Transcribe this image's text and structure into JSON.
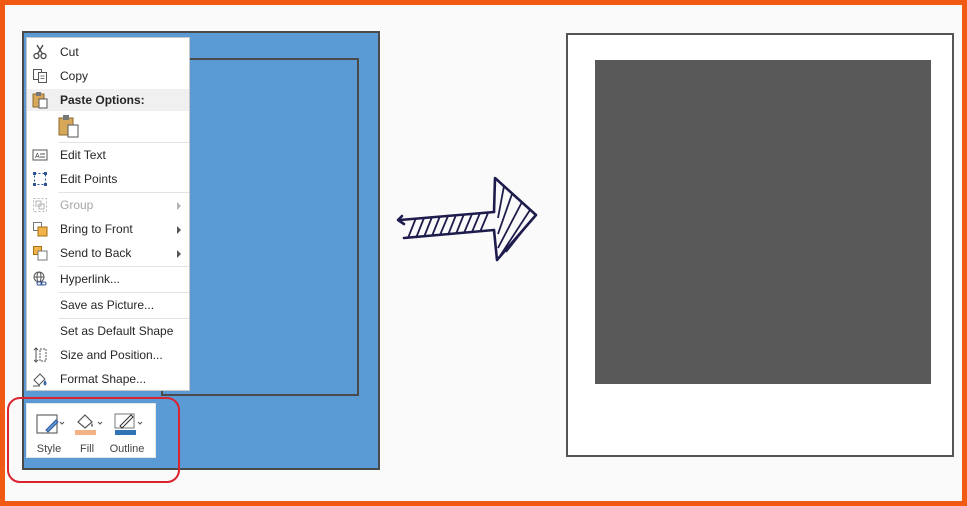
{
  "context_menu": {
    "items": [
      {
        "label": "Cut",
        "icon": "scissors-icon"
      },
      {
        "label": "Copy",
        "icon": "copy-icon"
      },
      {
        "label": "Paste Options:",
        "icon": "clipboard-icon"
      },
      {
        "label": "Edit Text",
        "icon": "edit-text-icon"
      },
      {
        "label": "Edit Points",
        "icon": "edit-points-icon"
      },
      {
        "label": "Group",
        "icon": "group-icon",
        "disabled": true,
        "submenu": true
      },
      {
        "label": "Bring to Front",
        "icon": "bring-to-front-icon",
        "submenu": true
      },
      {
        "label": "Send to Back",
        "icon": "send-to-back-icon",
        "submenu": true
      },
      {
        "label": "Hyperlink...",
        "icon": "hyperlink-icon"
      },
      {
        "label": "Save as Picture...",
        "icon": ""
      },
      {
        "label": "Set as Default Shape",
        "icon": ""
      },
      {
        "label": "Size and Position...",
        "icon": "size-position-icon"
      },
      {
        "label": "Format Shape...",
        "icon": "format-shape-icon"
      }
    ]
  },
  "mini_toolbar": {
    "style_label": "Style",
    "fill_label": "Fill",
    "outline_label": "Outline"
  },
  "colors": {
    "frame_border": "#f05a13",
    "shape_fill": "#5b9bd5",
    "result_fill": "#595959",
    "highlight": "#d9232e",
    "arrow_ink": "#1e1c4c"
  }
}
